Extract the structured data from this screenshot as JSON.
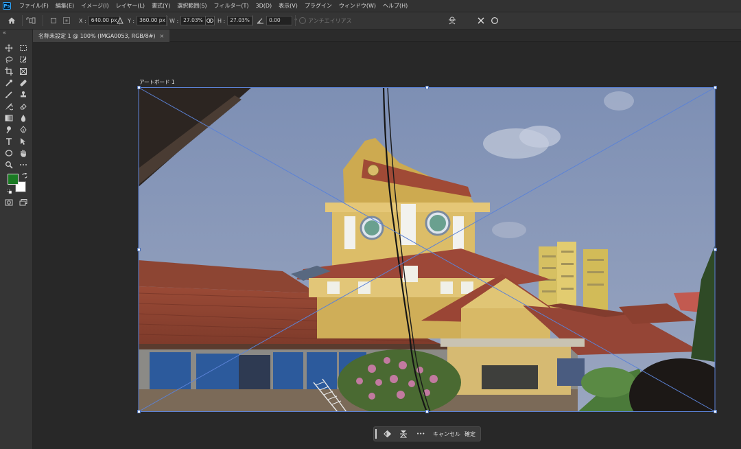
{
  "menu": {
    "app_icon": "Ps",
    "items": [
      "ファイル(F)",
      "編集(E)",
      "イメージ(I)",
      "レイヤー(L)",
      "書式(Y)",
      "選択範囲(S)",
      "フィルター(T)",
      "3D(D)",
      "表示(V)",
      "プラグイン",
      "ウィンドウ(W)",
      "ヘルプ(H)"
    ]
  },
  "options": {
    "x_label": "X :",
    "x_value": "640.00 px",
    "y_label": "Y :",
    "y_value": "360.00 px",
    "w_label": "W :",
    "w_value": "27.03%",
    "h_label": "H :",
    "h_value": "27.03%",
    "angle_value": "0.00",
    "angle_unit": "°",
    "antialias_label": "アンチエイリアス"
  },
  "document": {
    "tab_title": "名称未設定 1 @ 100% (IMGA0053, RGB/8#)",
    "close_icon": "×",
    "artboard_label": "アートボード 1"
  },
  "context_bar": {
    "more_label": "•••",
    "cancel_label": "キャンセル",
    "confirm_label": "確定"
  },
  "colors": {
    "foreground": "#1a7a23",
    "background": "#ffffff",
    "accent": "#31a8ff",
    "transform_line": "#5b82d6"
  }
}
